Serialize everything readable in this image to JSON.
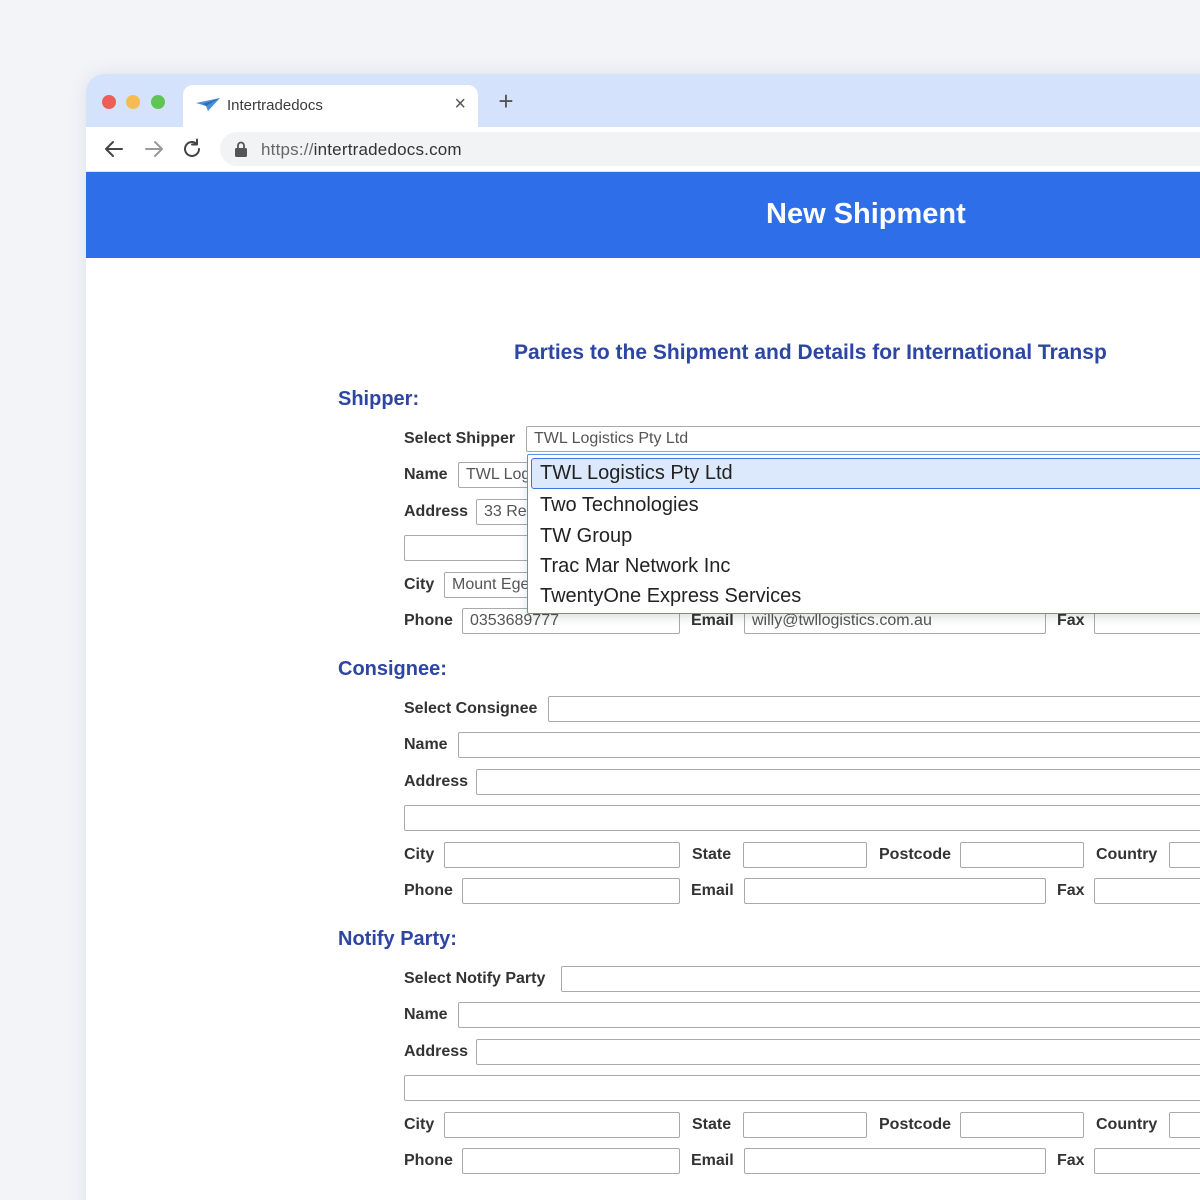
{
  "browser": {
    "tab_title": "Intertradedocs",
    "tab_close": "×",
    "new_tab": "+",
    "url_scheme": "https://",
    "url_host": "intertradedocs.com"
  },
  "header": {
    "title": "New Shipment"
  },
  "section_banner": "Parties to the Shipment and Details for International Transp",
  "shipper": {
    "title": "Shipper:",
    "select_label": "Select Shipper",
    "select_value": "TWL Logistics Pty Ltd",
    "name_label": "Name",
    "name_value": "TWL Log",
    "address_label": "Address",
    "address_value": "33 Re",
    "city_label": "City",
    "city_value": "Mount Ege",
    "phone_label": "Phone",
    "phone_value": "0353689777",
    "email_label": "Email",
    "email_value": "willy@twllogistics.com.au",
    "fax_label": "Fax",
    "dropdown_options": [
      "TWL Logistics Pty Ltd",
      "Two Technologies",
      "TW Group",
      "Trac Mar Network Inc",
      "TwentyOne Express Services"
    ]
  },
  "consignee": {
    "title": "Consignee:",
    "select_label": "Select Consignee",
    "name_label": "Name",
    "address_label": "Address",
    "city_label": "City",
    "state_label": "State",
    "postcode_label": "Postcode",
    "country_label": "Country",
    "phone_label": "Phone",
    "email_label": "Email",
    "fax_label": "Fax"
  },
  "notify": {
    "title": "Notify Party:",
    "select_label": "Select Notify Party",
    "name_label": "Name",
    "address_label": "Address",
    "city_label": "City",
    "state_label": "State",
    "postcode_label": "Postcode",
    "country_label": "Country",
    "phone_label": "Phone",
    "email_label": "Email",
    "fax_label": "Fax"
  },
  "colors": {
    "header_bg": "#2f6ee9",
    "section_title": "#2d45a3",
    "tabstrip_bg": "#d4e3fb"
  }
}
